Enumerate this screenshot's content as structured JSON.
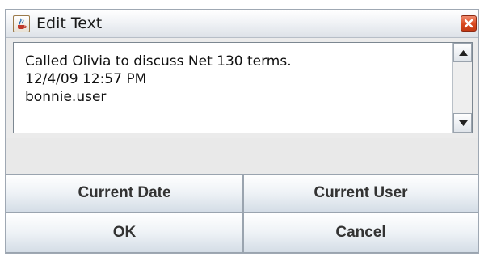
{
  "window": {
    "title": "Edit Text",
    "app_icon": "java-cup-icon",
    "close_icon": "close-icon"
  },
  "text_area": {
    "lines": [
      "Called Olivia to discuss Net 130 terms.",
      "12/4/09 12:57 PM",
      "bonnie.user"
    ]
  },
  "scrollbar": {
    "up_icon": "scroll-up-arrow-icon",
    "down_icon": "scroll-down-arrow-icon"
  },
  "buttons": {
    "current_date": "Current Date",
    "current_user": "Current User",
    "ok": "OK",
    "cancel": "Cancel"
  },
  "colors": {
    "close_button": "#d9481f",
    "button_gradient_top": "#ffffff",
    "button_gradient_bottom": "#d4dde6"
  }
}
